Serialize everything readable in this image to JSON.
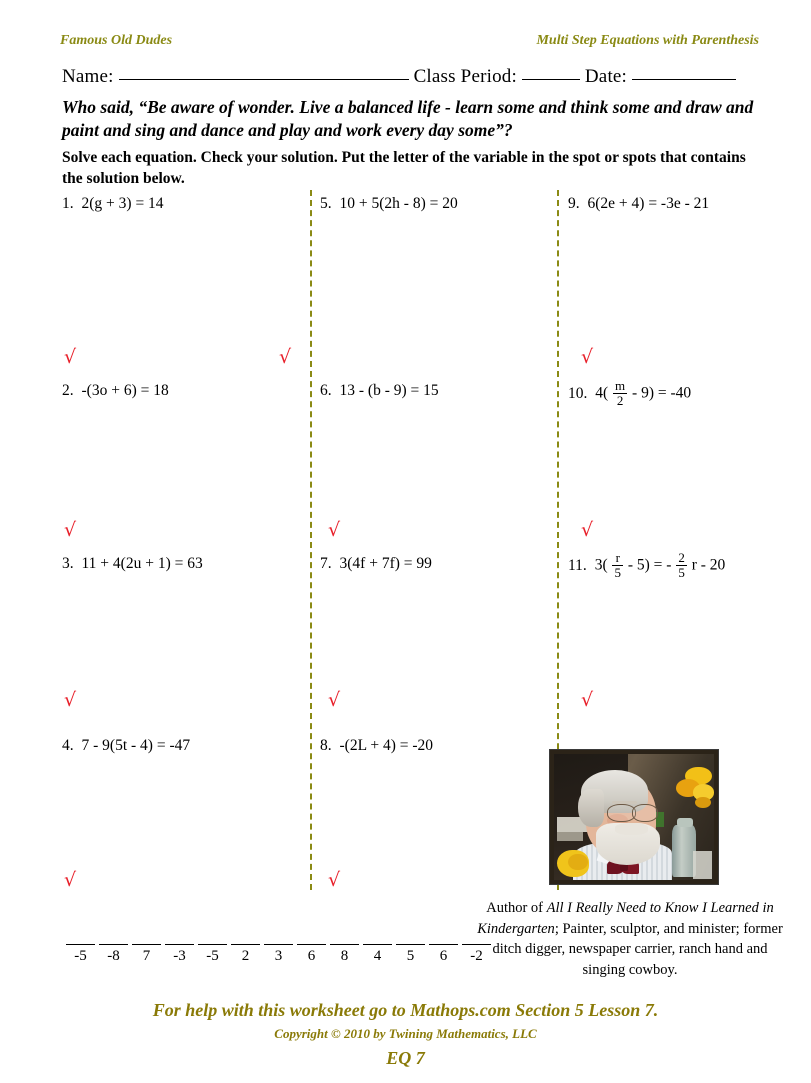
{
  "header": {
    "left": "Famous Old Dudes",
    "right": "Multi Step Equations with Parenthesis",
    "color": "#8a8a14"
  },
  "name_line": {
    "name_label": "Name:",
    "class_period_label": "Class Period:",
    "date_label": "Date:"
  },
  "quote": "Who said, “Be aware of wonder.  Live a balanced life - learn some and think some and draw and paint and sing and dance and play and work every day some”?",
  "directions": "Solve each equation.  Check your solution.  Put the letter of the variable in the spot or spots that contains the solution below.",
  "problems": {
    "column_1": [
      {
        "num": "1.",
        "text": "2(g + 3) = 14"
      },
      {
        "num": "2.",
        "text": "-(3o + 6) = 18"
      },
      {
        "num": "3.",
        "text": "11 + 4(2u + 1) = 63"
      },
      {
        "num": "4.",
        "text": "7 - 9(5t - 4) = -47"
      }
    ],
    "column_2": [
      {
        "num": "5.",
        "text": "10 + 5(2h - 8) = 20"
      },
      {
        "num": "6.",
        "text": "13 - (b - 9) = 15"
      },
      {
        "num": "7.",
        "text": "3(4f + 7f) = 99"
      },
      {
        "num": "8.",
        "text": "-(2L + 4) = -20"
      }
    ],
    "column_3": [
      {
        "num": "9.",
        "text": "6(2e + 4) = -3e - 21"
      },
      {
        "num": "10.",
        "pre": "4(",
        "frac_top": "m",
        "frac_bot": "2",
        "post": "- 9)  =  -40"
      },
      {
        "num": "11.",
        "pre": "3(",
        "frac_top": "r",
        "frac_bot": "5",
        "mid": "- 5)  =  -",
        "frac2_top": "2",
        "frac2_bot": "5",
        "post": "r  - 20"
      }
    ]
  },
  "check_mark": "√",
  "check_mark_color": "#e8202a",
  "answer_blanks": {
    "values": [
      "-5",
      "-8",
      "7",
      "-3",
      "-5",
      "2",
      "3",
      "6",
      "8",
      "4",
      "5",
      "6",
      "-2"
    ]
  },
  "photo_caption": {
    "line1_pre": "Author of ",
    "line1_italic": "All I Really Need to Know I Learned",
    "line2_italic": "in Kindergarten",
    "line2_post": "; Painter, sculptor, and",
    "line3": "minister; former ditch digger, newspaper",
    "line4": "carrier, ranch hand and singing cowboy."
  },
  "footer": {
    "help": "For help with this worksheet go to Mathops.com Section 5 Lesson 7.",
    "copyright": "Copyright © 2010 by Twining Mathematics, LLC",
    "code": "EQ 7",
    "color": "#8a7a07"
  }
}
